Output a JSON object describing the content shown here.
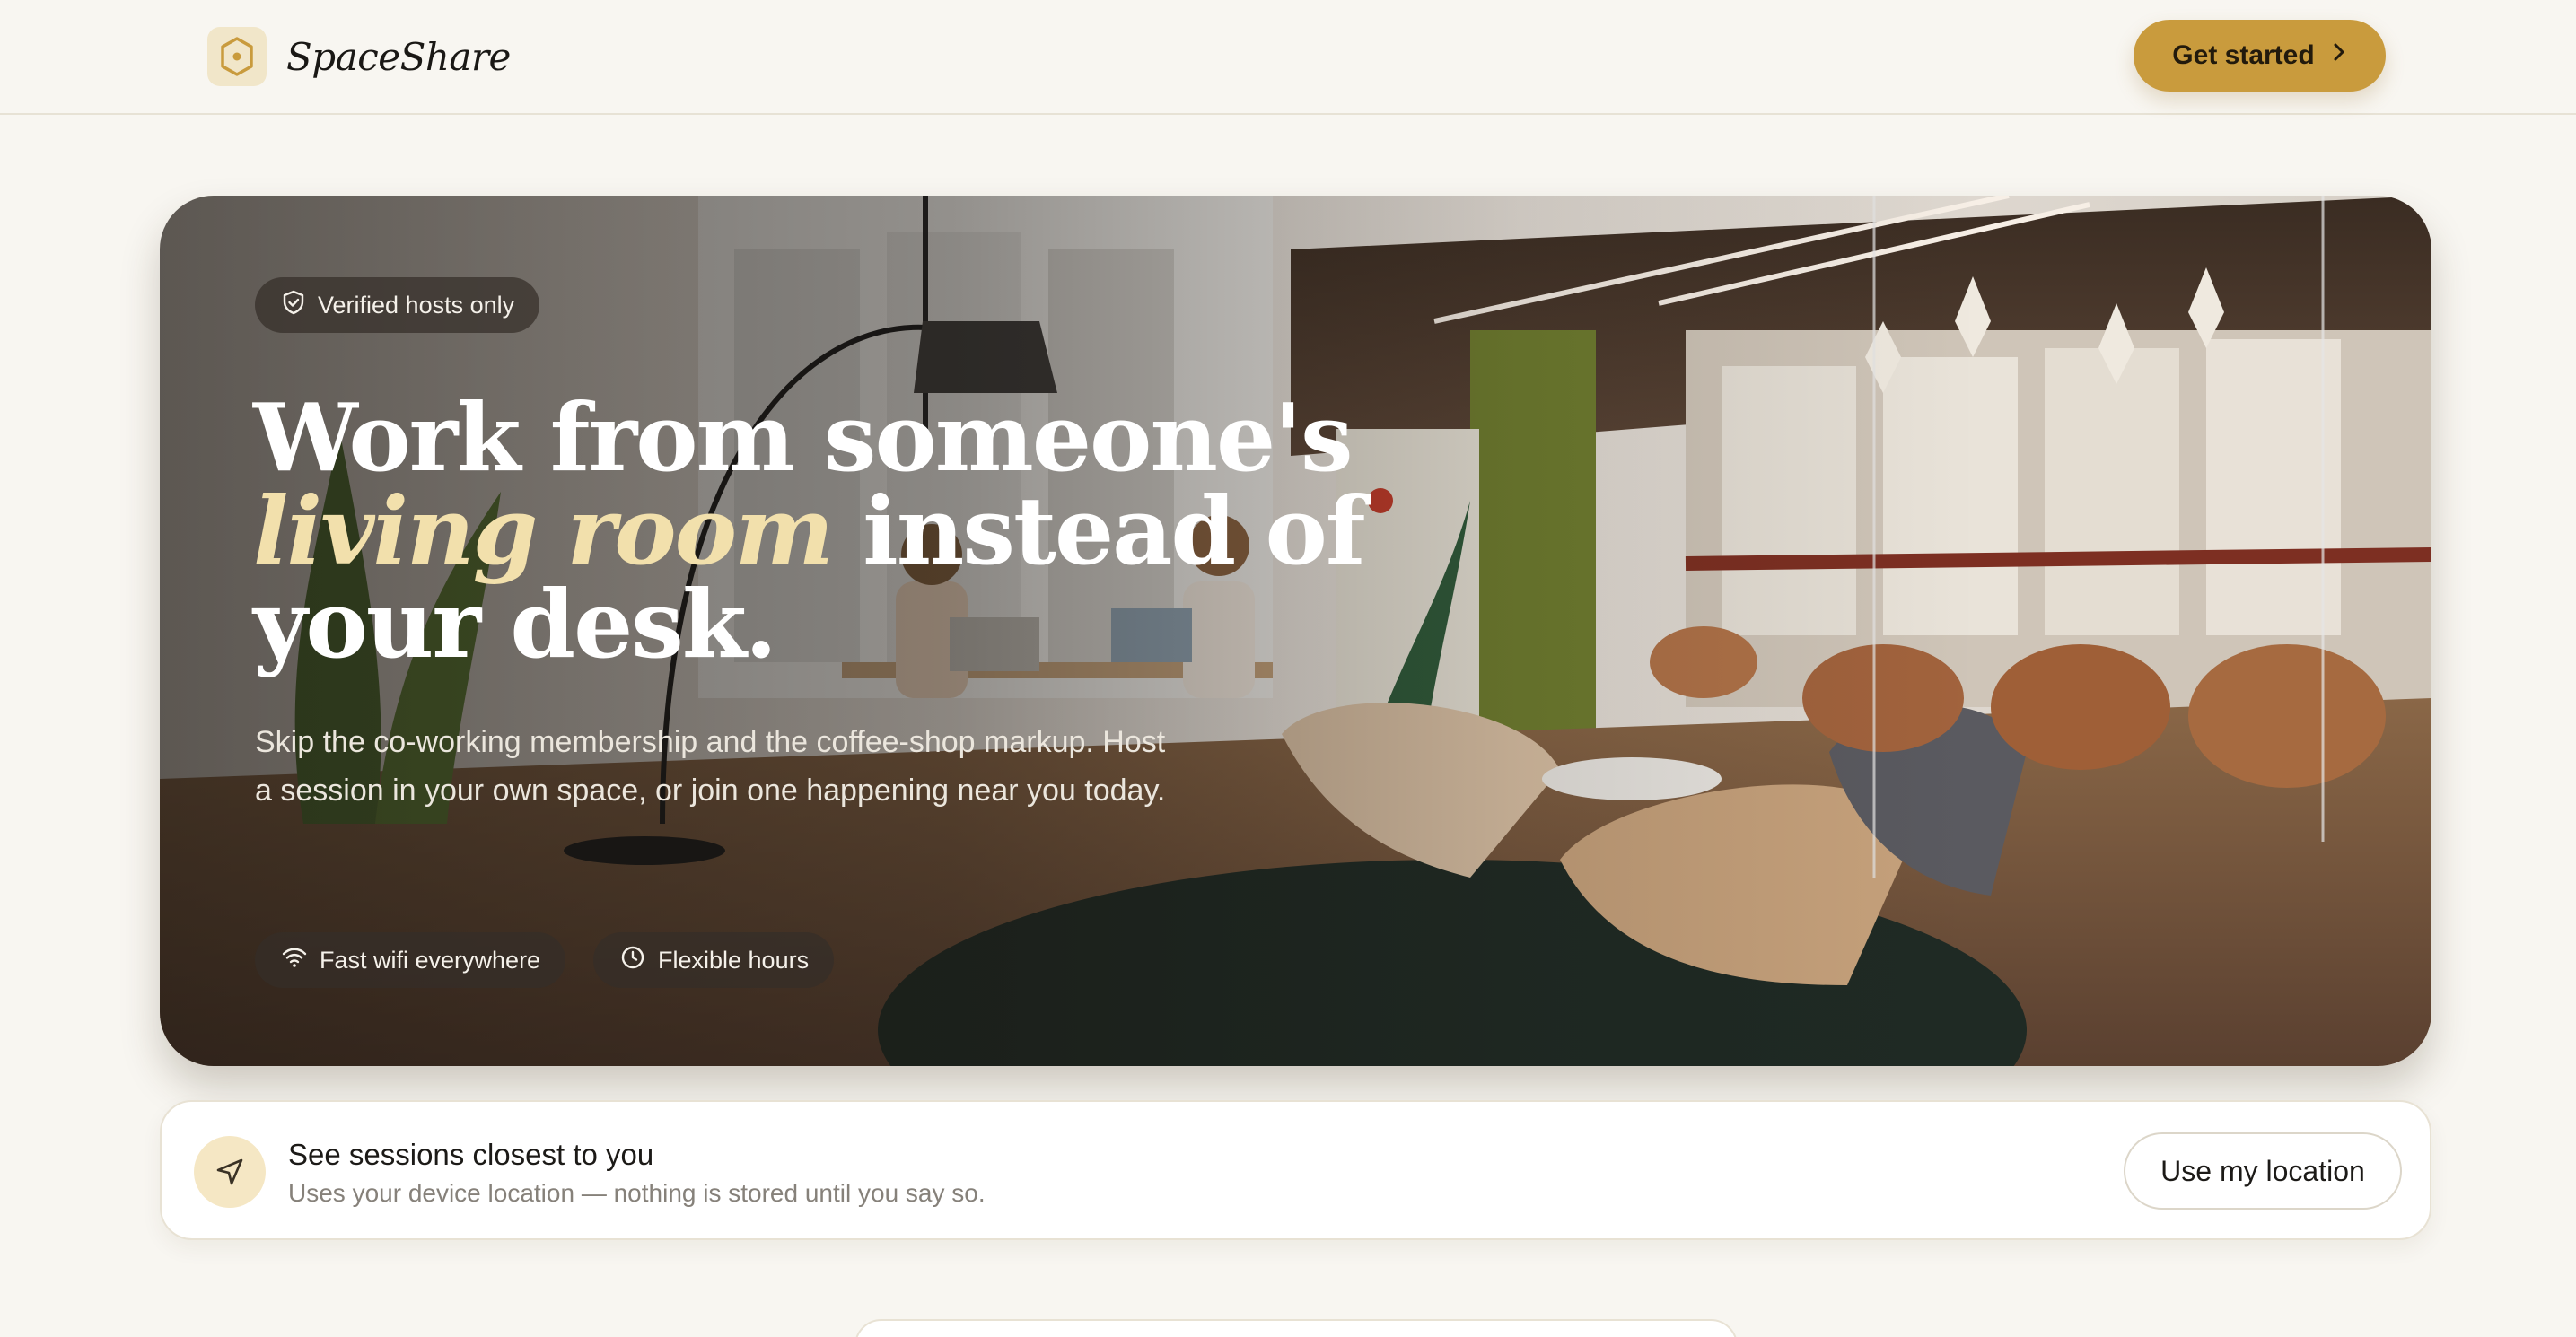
{
  "header": {
    "brand_name": "SpaceShare",
    "cta_label": "Get started",
    "logo_icon": "hexagon-pin-icon",
    "cta_icon": "chevron-right-icon"
  },
  "hero": {
    "badge": "Verified hosts only",
    "headline_line1": "Work from someone's",
    "headline_accent": "living room",
    "headline_line2_rest": "instead of",
    "headline_line3": "your desk.",
    "subtitle": "Skip the co-working membership and the coffee-shop markup. Host a session in your own space, or join one happening near you today.",
    "features": [
      {
        "label": "Fast wifi everywhere",
        "icon": "wifi-icon"
      },
      {
        "label": "Flexible hours",
        "icon": "clock-icon"
      }
    ]
  },
  "location": {
    "title": "See sessions closest to you",
    "subtitle": "Uses your device location — nothing is stored until you say so.",
    "button_label": "Use my location",
    "icon": "navigation-arrow-icon"
  },
  "colors": {
    "background": "#f8f6f1",
    "accent": "#c99b3d",
    "accent_text": "#f2e0ac",
    "icon_bg": "#f5e7c4"
  }
}
